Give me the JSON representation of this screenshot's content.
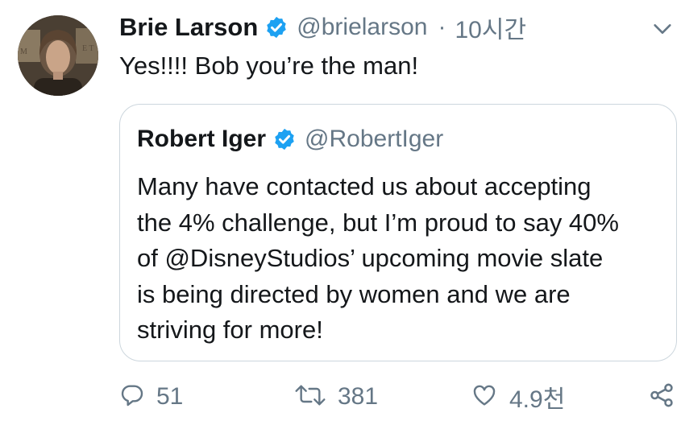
{
  "author": {
    "name": "Brie Larson",
    "handle": "@brielarson",
    "separator": "·",
    "time": "10시간"
  },
  "tweet": {
    "text": "Yes!!!! Bob you’re the man!"
  },
  "quoted": {
    "name": "Robert Iger",
    "handle": "@RobertIger",
    "lines": [
      "Many have contacted us about accepting",
      "the 4% challenge, but I’m proud to say 40%",
      "of @DisneyStudios’ upcoming movie slate",
      "is being directed by women and we are",
      "striving for more!"
    ]
  },
  "actions": {
    "replies": "51",
    "retweets": "381",
    "likes": "4.9천"
  },
  "colors": {
    "verified": "#1da1f2",
    "secondary_text": "#657786",
    "border": "#ccd6dd"
  },
  "icons": [
    "verified-badge-icon",
    "chevron-down-icon",
    "reply-icon",
    "retweet-icon",
    "like-icon",
    "share-icon"
  ]
}
